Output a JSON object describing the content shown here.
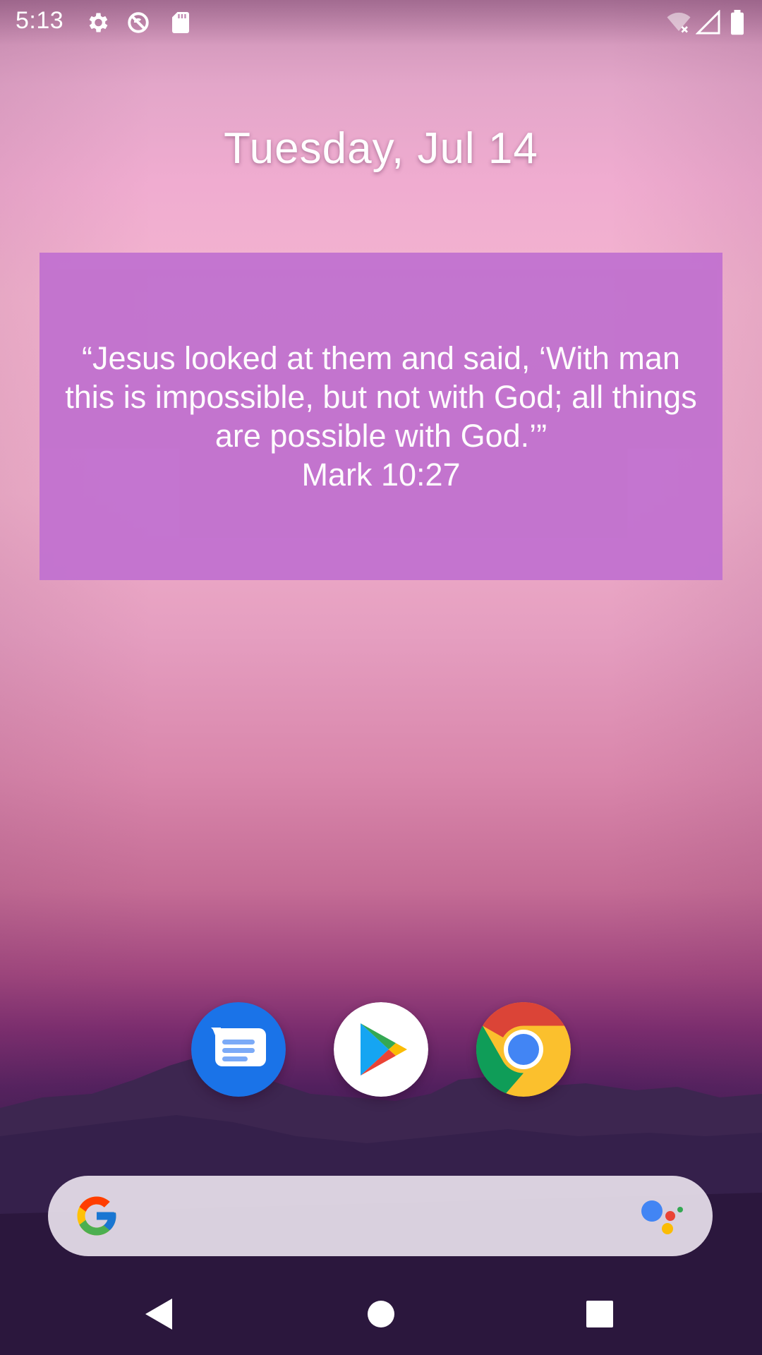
{
  "status_bar": {
    "time": "5:13",
    "icons": [
      "settings-icon",
      "sync-disabled-icon",
      "sd-card-icon",
      "wifi-off-icon",
      "cell-signal-icon",
      "battery-icon"
    ]
  },
  "date_widget": {
    "text": "Tuesday, Jul 14"
  },
  "verse_widget": {
    "quote": "“Jesus looked at them and said, ‘With man this is impossible, but not with God; all things are possible with God.’”",
    "reference": "Mark 10:27",
    "background_color": "#c273cf"
  },
  "dock": {
    "apps": [
      "messages-icon",
      "play-store-icon",
      "chrome-icon"
    ]
  },
  "search_bar": {
    "icons": [
      "google-g-icon",
      "google-assistant-icon"
    ]
  },
  "nav_bar": {
    "buttons": [
      "back-icon",
      "home-icon",
      "recents-icon"
    ]
  }
}
